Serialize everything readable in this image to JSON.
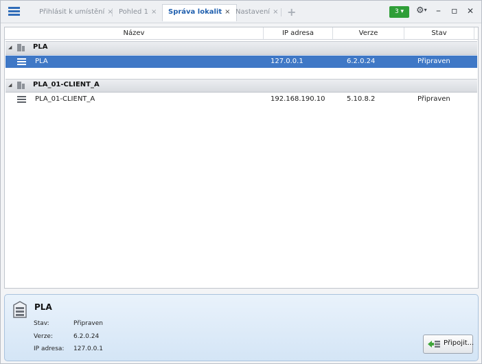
{
  "menu_icon": "hamburger-menu-icon",
  "tabs": [
    {
      "label": "Přihlásit k umístění",
      "close": "×",
      "active": false
    },
    {
      "label": "Pohled 1",
      "close": "×",
      "active": false
    },
    {
      "label": "Správa lokalit",
      "close": "×",
      "active": true
    },
    {
      "label": "Nastavení",
      "close": "×",
      "active": false
    }
  ],
  "toolbar": {
    "add_tab": "+",
    "badge": "3 ▾",
    "badge_color": "#2f9e38",
    "gear": "⚙",
    "gear_caret": "▾",
    "minimize": "–",
    "maximize": "▫",
    "close": "✕"
  },
  "grid": {
    "columns": [
      "Název",
      "IP adresa",
      "Verze",
      "Stav"
    ],
    "groups": [
      {
        "name": "PLA",
        "expander": "◢",
        "rows": [
          {
            "name": "PLA",
            "ip": "127.0.0.1",
            "version": "6.2.0.24",
            "status": "Připraven",
            "selected": true
          }
        ]
      },
      {
        "name": "PLA_01-CLIENT_A",
        "expander": "◢",
        "rows": [
          {
            "name": "PLA_01-CLIENT_A",
            "ip": "192.168.190.10",
            "version": "5.10.8.2",
            "status": "Připraven",
            "selected": false
          }
        ]
      }
    ],
    "selection_color": "#3f78c6"
  },
  "details": {
    "title": "PLA",
    "status_label": "Stav:",
    "status_value": "Připraven",
    "version_label": "Verze:",
    "version_value": "6.2.0.24",
    "ip_label": "IP adresa:",
    "ip_value": "127.0.0.1",
    "connect_button": "Připojit..."
  }
}
